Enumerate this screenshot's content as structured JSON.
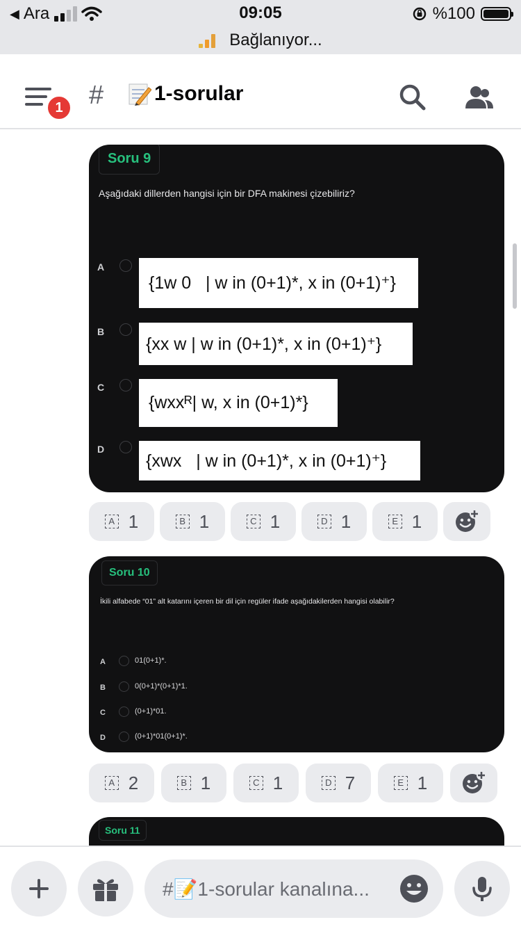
{
  "status_bar": {
    "carrier": "Ara",
    "time": "09:05",
    "battery_percent": "%100",
    "connection_status": "Bağlanıyor..."
  },
  "header": {
    "notification_count": "1",
    "channel_hash": "#",
    "channel_name": "1-sorular"
  },
  "questions": [
    {
      "tag": "Soru 9",
      "text": "Aşağıdaki dillerden hangisi için bir DFA makinesi çizebiliriz?",
      "options": [
        {
          "letter": "A",
          "formula": "{1w 0   | w in (0+1)*, x in (0+1)⁺}"
        },
        {
          "letter": "B",
          "formula": "{xx w | w in (0+1)*, x in (0+1)⁺}"
        },
        {
          "letter": "C",
          "formula": "{wxxᴿ| w, x in (0+1)*}"
        },
        {
          "letter": "D",
          "formula": "{xwx   | w in (0+1)*, x in (0+1)⁺}"
        }
      ],
      "reactions": [
        {
          "label": "A",
          "count": "1"
        },
        {
          "label": "B",
          "count": "1"
        },
        {
          "label": "C",
          "count": "1"
        },
        {
          "label": "D",
          "count": "1"
        },
        {
          "label": "E",
          "count": "1"
        }
      ]
    },
    {
      "tag": "Soru 10",
      "text": "İkili alfabede “01” alt katarını içeren bir dil için regüler ifade aşağıdakilerden hangisi olabilir?",
      "options": [
        {
          "letter": "A",
          "formula": "01(0+1)*."
        },
        {
          "letter": "B",
          "formula": "0(0+1)*(0+1)*1."
        },
        {
          "letter": "C",
          "formula": "(0+1)*01."
        },
        {
          "letter": "D",
          "formula": "(0+1)*01(0+1)*."
        }
      ],
      "reactions": [
        {
          "label": "A",
          "count": "2"
        },
        {
          "label": "B",
          "count": "1"
        },
        {
          "label": "C",
          "count": "1"
        },
        {
          "label": "D",
          "count": "7"
        },
        {
          "label": "E",
          "count": "1"
        }
      ]
    },
    {
      "tag": "Soru 11"
    }
  ],
  "composer": {
    "placeholder": "#📝1-sorular kanalına..."
  }
}
